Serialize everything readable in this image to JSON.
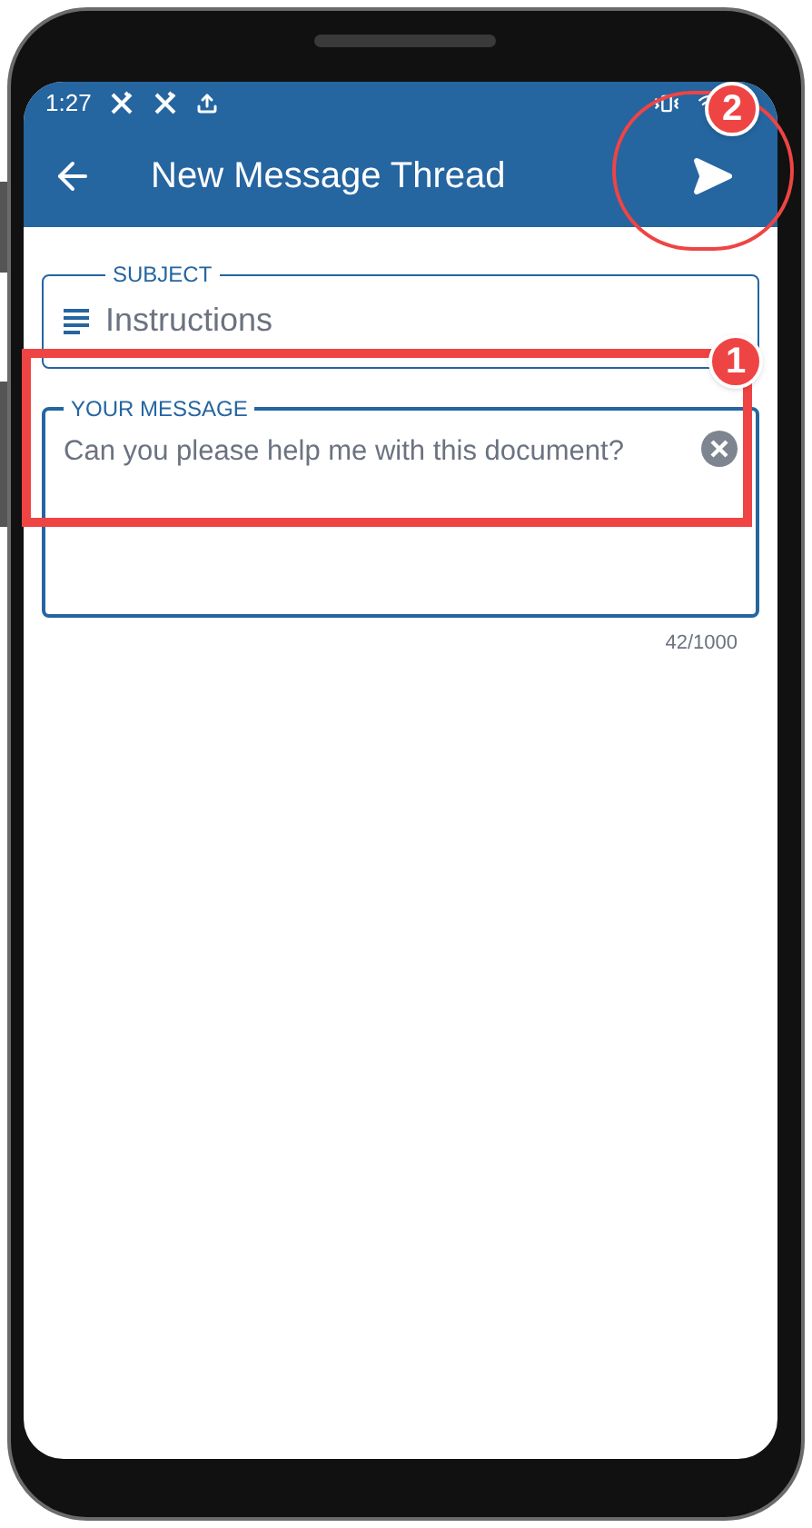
{
  "status_bar": {
    "time": "1:27"
  },
  "app_bar": {
    "title": "New Message Thread"
  },
  "subject": {
    "label": "SUBJECT",
    "value": "Instructions"
  },
  "message": {
    "label": "YOUR MESSAGE",
    "value": "Can you please help me with this document?",
    "counter": "42/1000"
  },
  "callouts": [
    {
      "number": "2"
    },
    {
      "number": "1"
    }
  ]
}
